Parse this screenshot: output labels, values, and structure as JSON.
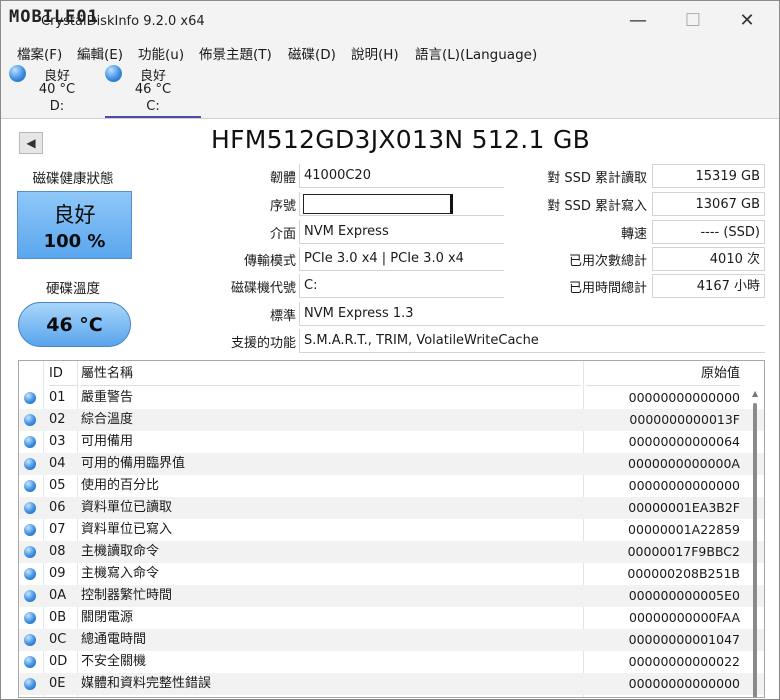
{
  "titlebar": {
    "watermark": "MOBILE01",
    "app_title": "CrystalDiskInfo 9.2.0 x64",
    "minimize": "—",
    "maximize": "☐",
    "close": "✕"
  },
  "menu": [
    "檔案(F)",
    "編輯(E)",
    "功能(u)",
    "佈景主題(T)",
    "磁碟(D)",
    "說明(H)",
    "語言(L)(Language)"
  ],
  "drives": [
    {
      "status": "良好",
      "temp": "40 °C",
      "letter": "D:"
    },
    {
      "status": "良好",
      "temp": "46 °C",
      "letter": "C:"
    }
  ],
  "model": {
    "title": "HFM512GD3JX013N 512.1 GB"
  },
  "health": {
    "label": "磁碟健康狀態",
    "status": "良好",
    "percent": "100 %"
  },
  "temperature": {
    "label": "硬碟溫度",
    "value": "46 °C"
  },
  "info_left": [
    {
      "label": "韌體",
      "value": "41000C20"
    },
    {
      "label": "序號",
      "value": ""
    },
    {
      "label": "介面",
      "value": "NVM Express"
    },
    {
      "label": "傳輸模式",
      "value": "PCIe 3.0 x4 | PCIe 3.0 x4"
    },
    {
      "label": "磁碟機代號",
      "value": "C:"
    },
    {
      "label": "標準",
      "value": "NVM Express 1.3"
    },
    {
      "label": "支援的功能",
      "value": "S.M.A.R.T., TRIM, VolatileWriteCache"
    }
  ],
  "info_right": [
    {
      "label": "對 SSD 累計讀取",
      "value": "15319 GB"
    },
    {
      "label": "對 SSD 累計寫入",
      "value": "13067 GB"
    },
    {
      "label": "轉速",
      "value": "---- (SSD)"
    },
    {
      "label": "已用次數總計",
      "value": "4010 次"
    },
    {
      "label": "已用時間總計",
      "value": "4167 小時"
    }
  ],
  "table": {
    "headers": {
      "id": "ID",
      "name": "屬性名稱",
      "raw": "原始值"
    },
    "rows": [
      {
        "id": "01",
        "name": "嚴重警告",
        "raw": "00000000000000"
      },
      {
        "id": "02",
        "name": "綜合溫度",
        "raw": "0000000000013F"
      },
      {
        "id": "03",
        "name": "可用備用",
        "raw": "00000000000064"
      },
      {
        "id": "04",
        "name": "可用的備用臨界值",
        "raw": "0000000000000A"
      },
      {
        "id": "05",
        "name": "使用的百分比",
        "raw": "00000000000000"
      },
      {
        "id": "06",
        "name": "資料單位已讀取",
        "raw": "00000001EA3B2F"
      },
      {
        "id": "07",
        "name": "資料單位已寫入",
        "raw": "00000001A22859"
      },
      {
        "id": "08",
        "name": "主機讀取命令",
        "raw": "00000017F9BBC2"
      },
      {
        "id": "09",
        "name": "主機寫入命令",
        "raw": "000000208B251B"
      },
      {
        "id": "0A",
        "name": "控制器繁忙時間",
        "raw": "000000000005E0"
      },
      {
        "id": "0B",
        "name": "關閉電源",
        "raw": "00000000000FAA"
      },
      {
        "id": "0C",
        "name": "總通電時間",
        "raw": "00000000001047"
      },
      {
        "id": "0D",
        "name": "不安全關機",
        "raw": "00000000000022"
      },
      {
        "id": "0E",
        "name": "媒體和資料完整性錯誤",
        "raw": "00000000000000"
      }
    ]
  }
}
